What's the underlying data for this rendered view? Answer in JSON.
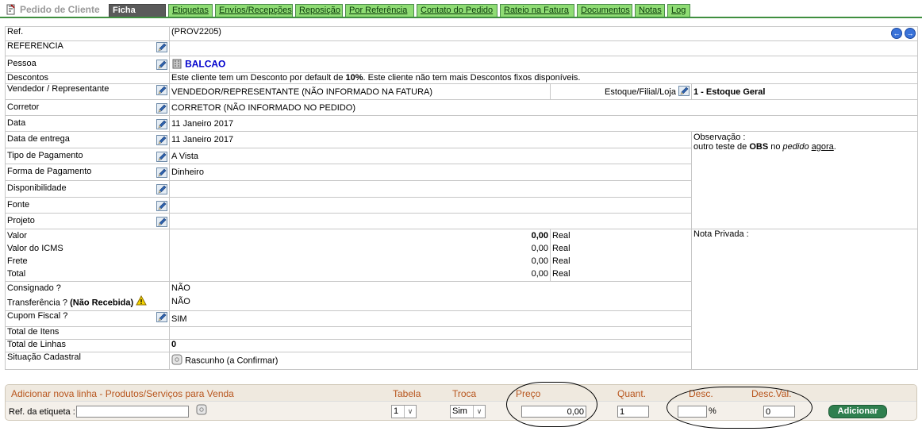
{
  "tabs": {
    "current_section": "Pedido de Cliente",
    "items": [
      "Ficha Pedido",
      "Etiquetas",
      "Envíos/Recepções",
      "Reposição",
      "Por Referência",
      "Contato do Pedido",
      "Rateio na Fatura",
      "Documentos",
      "Notas",
      "Log"
    ]
  },
  "form": {
    "ref": {
      "label": "Ref.",
      "value": "(PROV2205)"
    },
    "referencia": {
      "label": "REFERENCIA",
      "value": ""
    },
    "pessoa": {
      "label": "Pessoa",
      "value": "BALCAO"
    },
    "descontos": {
      "label": "Descontos",
      "text_a": "Este cliente tem um Desconto por default de ",
      "pct": "10%",
      "text_b": ". Este cliente não tem mais Descontos fixos disponíveis."
    },
    "vendedor": {
      "label": "Vendedor / Representante",
      "value": "VENDEDOR/REPRESENTANTE (NÃO INFORMADO NA FATURA)"
    },
    "estoque": {
      "label": "Estoque/Filial/Loja",
      "value": "1 - Estoque Geral"
    },
    "corretor": {
      "label": "Corretor",
      "value": "CORRETOR (NÃO INFORMADO NO PEDIDO)"
    },
    "data": {
      "label": "Data",
      "value": "11 Janeiro 2017"
    },
    "data_entrega": {
      "label": "Data de entrega",
      "value": "11 Janeiro 2017"
    },
    "tipo_pagamento": {
      "label": "Tipo de Pagamento",
      "value": "A Vista"
    },
    "forma_pagamento": {
      "label": "Forma de Pagamento",
      "value": "Dinheiro"
    },
    "disponibilidade": {
      "label": "Disponibilidade",
      "value": ""
    },
    "fonte": {
      "label": "Fonte",
      "value": ""
    },
    "projeto": {
      "label": "Projeto",
      "value": ""
    },
    "observacao": {
      "label": "Observação :",
      "t1": "outro teste de ",
      "t2": "OBS",
      "t3": " no ",
      "t4": "pedido",
      "t5": " ",
      "t6": "agora",
      "t7": "."
    },
    "valor": {
      "label": "Valor",
      "value": "0,00",
      "unit": "Real"
    },
    "valor_icms": {
      "label": "Valor do ICMS",
      "value": "0,00",
      "unit": "Real"
    },
    "frete": {
      "label": "Frete",
      "value": "0,00",
      "unit": "Real"
    },
    "total": {
      "label": "Total",
      "value": "0,00",
      "unit": "Real"
    },
    "nota_privada": {
      "label": "Nota Privada :"
    },
    "consignado": {
      "label": "Consignado ?",
      "value": "NÃO"
    },
    "transferencia": {
      "label": "Transferência ?",
      "label_bold": "(Não Recebida)",
      "value": "NÃO"
    },
    "cupom": {
      "label": "Cupom Fiscal ?",
      "value": "SIM"
    },
    "total_itens": {
      "label": "Total de Itens",
      "value": ""
    },
    "total_linhas": {
      "label": "Total de Linhas",
      "value": "0"
    },
    "situacao": {
      "label": "Situação Cadastral",
      "value": "Rascunho (a Confirmar)"
    }
  },
  "add_line": {
    "title": "Adicionar nova linha - Produtos/Serviços para Venda",
    "ref_label": "Ref. da etiqueta :",
    "ref_value": "",
    "tabela": {
      "label": "Tabela",
      "value": "1"
    },
    "troca": {
      "label": "Troca",
      "value": "Sim"
    },
    "preco": {
      "label": "Preço",
      "value": "0,00"
    },
    "quant": {
      "label": "Quant.",
      "value": "1"
    },
    "desc": {
      "label": "Desc.",
      "value": "",
      "unit": "%"
    },
    "desc_val": {
      "label": "Desc.Val.",
      "value": "0"
    },
    "button": "Adicionar"
  },
  "colors": {
    "tab_green": "#8fdc74",
    "tab_active": "#5a5a5a",
    "header_text": "#b8561e",
    "link_blue": "#0000cc"
  }
}
